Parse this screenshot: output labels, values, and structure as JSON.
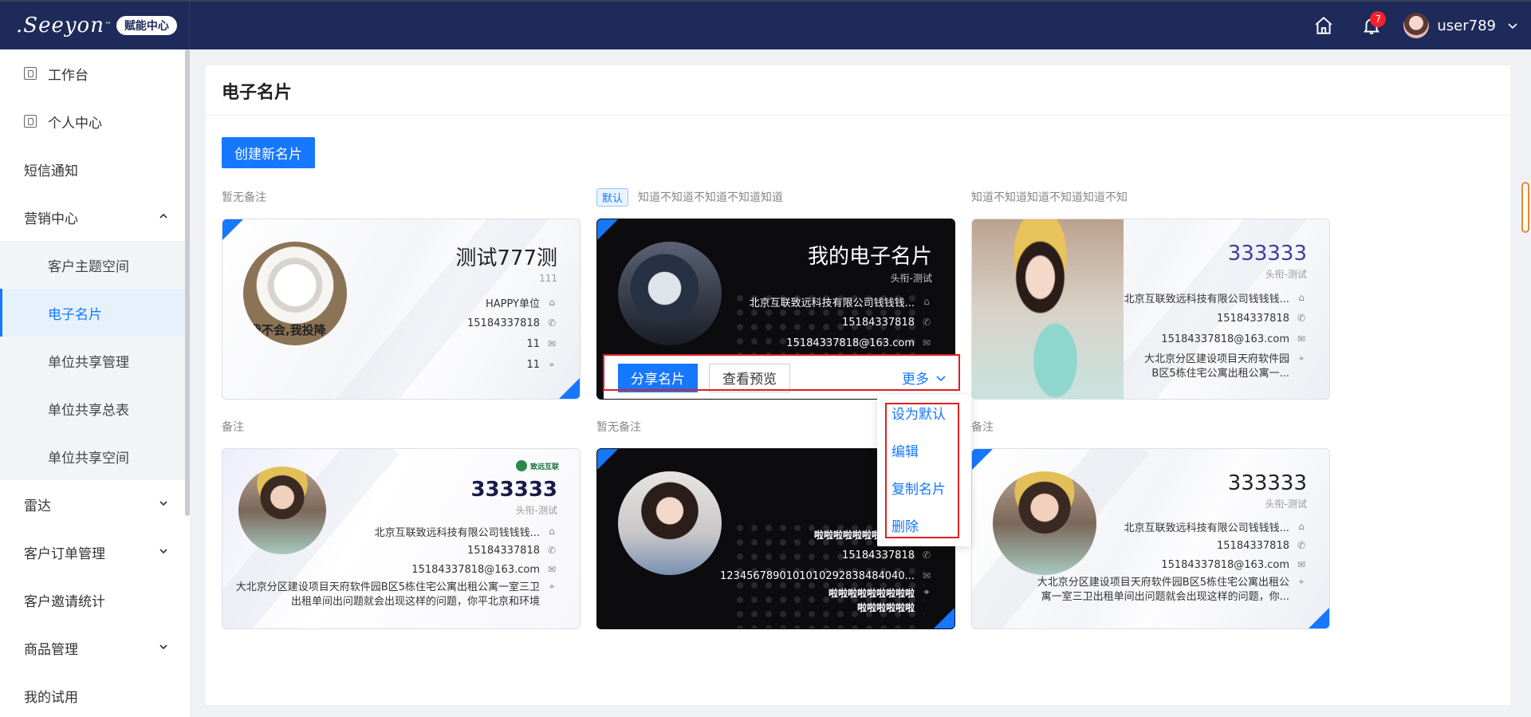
{
  "header": {
    "logo_text": ".Seeyon",
    "logo_tm": "™",
    "logo_badge": "赋能中心",
    "notification_count": "7",
    "username": "user789"
  },
  "sidebar": {
    "items": [
      {
        "label": "工作台"
      },
      {
        "label": "个人中心"
      },
      {
        "label": "短信通知"
      },
      {
        "label": "营销中心"
      },
      {
        "label": "客户主题空间"
      },
      {
        "label": "电子名片"
      },
      {
        "label": "单位共享管理"
      },
      {
        "label": "单位共享总表"
      },
      {
        "label": "单位共享空间"
      },
      {
        "label": "雷达"
      },
      {
        "label": "客户订单管理"
      },
      {
        "label": "客户邀请统计"
      },
      {
        "label": "商品管理"
      },
      {
        "label": "我的试用"
      }
    ]
  },
  "main": {
    "title": "电子名片",
    "create_button": "创建新名片",
    "default_tag": "默认"
  },
  "cards": [
    {
      "note": "暂无备注",
      "name": "测试777测",
      "subtitle": "111",
      "photo_caption": "我不会,我投降",
      "company": "HAPPY单位",
      "phone": "15184337818",
      "email": "11",
      "address": "11"
    },
    {
      "note": "知道不知道不知道不知道知道",
      "name": "我的电子名片",
      "subtitle": "头衔-测试",
      "company": "北京互联致远科技有限公司钱钱钱...",
      "phone": "15184337818",
      "email": "15184337818@163.com"
    },
    {
      "note": "知道不知道知道不知道知道不知",
      "name": "333333",
      "subtitle": "头衔-测试",
      "company": "北京互联致远科技有限公司钱钱钱...",
      "phone": "15184337818",
      "email": "15184337818@163.com",
      "address": "大北京分区建设项目天府软件园B区5栋住宅公寓出租公寓一..."
    },
    {
      "note": "备注",
      "brand": "致远互联",
      "name": "333333",
      "subtitle": "头衔-测试",
      "company": "北京互联致远科技有限公司钱钱钱...",
      "phone": "15184337818",
      "email": "15184337818@163.com",
      "address": "大北京分区建设项目天府软件园B区5栋住宅公寓出租公寓一室三卫出租单间出问题就会出现这样的问题，你平北京和环境"
    },
    {
      "note": "暂无备注",
      "name": "啦啦啦啦啦啦啦 啦啦啦啦啦",
      "phone": "15184337818",
      "email": "1234567890101010292838484040...",
      "address": "啦啦啦啦啦啦啦啦啦啦啦啦啦啦啦"
    },
    {
      "note": "备注",
      "name": "333333",
      "subtitle": "头衔-测试",
      "company": "北京互联致远科技有限公司钱钱钱...",
      "phone": "15184337818",
      "email": "15184337818@163.com",
      "address": "大北京分区建设项目天府软件园B区5栋住宅公寓出租公寓一室三卫出租单间出问题就会出现这样的问题，你..."
    }
  ],
  "action_bar": {
    "share": "分享名片",
    "preview": "查看预览",
    "more": "更多"
  },
  "dropdown": {
    "items": [
      "设为默认",
      "编辑",
      "复制名片",
      "删除"
    ]
  },
  "colors": {
    "primary": "#1677ff",
    "header_bg": "#1e2a5a",
    "highlight_frame": "#e02020"
  }
}
